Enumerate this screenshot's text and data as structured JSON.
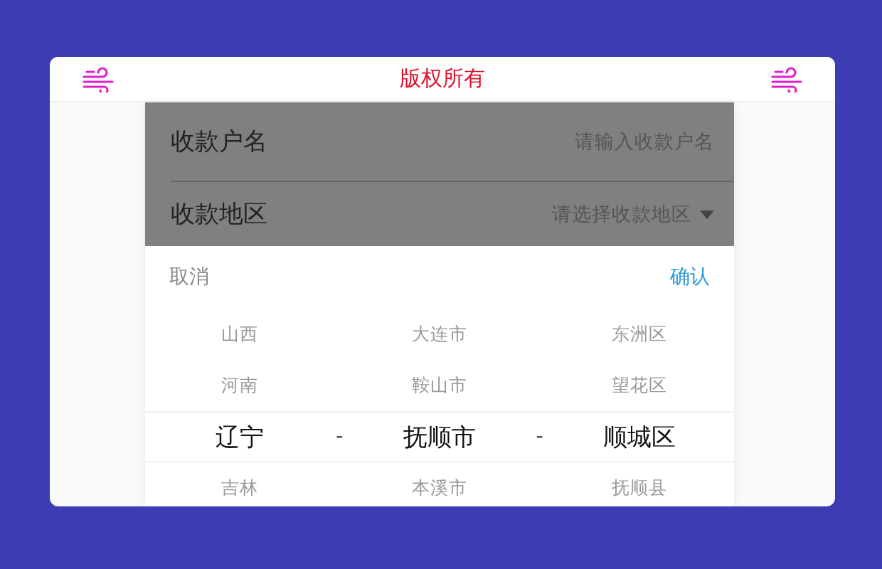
{
  "header": {
    "title": "版权所有"
  },
  "form": [
    {
      "kind": "input",
      "label": "收款户名",
      "placeholder": "请输入收款户名"
    },
    {
      "kind": "select",
      "label": "收款地区",
      "placeholder": "请选择收款地区"
    }
  ],
  "picker": {
    "cancel": "取消",
    "confirm": "确认",
    "separators": [
      "-",
      "-"
    ],
    "rows": [
      {
        "selected": false,
        "cells": [
          "山西",
          "大连市",
          "东洲区"
        ]
      },
      {
        "selected": false,
        "cells": [
          "河南",
          "鞍山市",
          "望花区"
        ]
      },
      {
        "selected": true,
        "cells": [
          "辽宁",
          "抚顺市",
          "顺城区"
        ]
      },
      {
        "selected": false,
        "cells": [
          "吉林",
          "本溪市",
          "抚顺县"
        ]
      }
    ]
  }
}
